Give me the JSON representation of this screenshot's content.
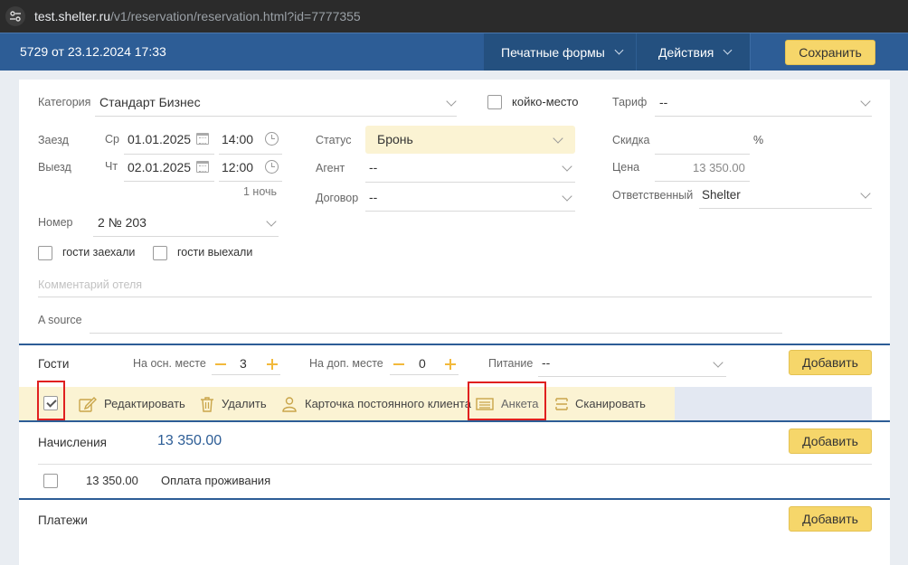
{
  "browser": {
    "url_host": "test.shelter.ru",
    "url_path": "/v1/reservation/reservation.html?id=7777355"
  },
  "header": {
    "title": "5729 от 23.12.2024 17:33",
    "print_forms": "Печатные формы",
    "actions": "Действия",
    "save": "Сохранить"
  },
  "form": {
    "category_label": "Категория",
    "category_value": "Стандарт Бизнес",
    "bed_place_label": "койко-место",
    "tariff_label": "Тариф",
    "tariff_value": "--",
    "checkin_label": "Заезд",
    "checkin_day": "Ср",
    "checkin_date": "01.01.2025",
    "checkin_time": "14:00",
    "checkout_label": "Выезд",
    "checkout_day": "Чт",
    "checkout_date": "02.01.2025",
    "checkout_time": "12:00",
    "nights": "1 ночь",
    "status_label": "Статус",
    "status_value": "Бронь",
    "agent_label": "Агент",
    "agent_value": "--",
    "contract_label": "Договор",
    "contract_value": "--",
    "discount_label": "Скидка",
    "discount_unit": "%",
    "price_label": "Цена",
    "price_value": "13 350.00",
    "responsible_label": "Ответственный",
    "responsible_value": "Shelter",
    "room_label": "Номер",
    "room_value": "2 № 203",
    "guests_arrived": "гости заехали",
    "guests_left": "гости выехали",
    "comment_placeholder": "Комментарий отеля",
    "source_label": "A source"
  },
  "guests": {
    "title": "Гости",
    "main_place_label": "На осн. месте",
    "main_place_count": "3",
    "extra_place_label": "На доп. месте",
    "extra_place_count": "0",
    "meals_label": "Питание",
    "meals_value": "--",
    "add": "Добавить",
    "toolbar": {
      "edit": "Редактировать",
      "delete": "Удалить",
      "loyalty_card": "Карточка постоянного клиента",
      "questionnaire": "Анкета",
      "scan": "Сканировать"
    }
  },
  "charges": {
    "title": "Начисления",
    "total": "13 350.00",
    "add": "Добавить",
    "rows": [
      {
        "amount": "13 350.00",
        "description": "Оплата проживания"
      }
    ]
  },
  "payments": {
    "title": "Платежи",
    "add": "Добавить"
  },
  "colors": {
    "header_blue": "#2d5d96",
    "accent_yellow": "#f6d66a",
    "highlight_red": "#e02020"
  }
}
